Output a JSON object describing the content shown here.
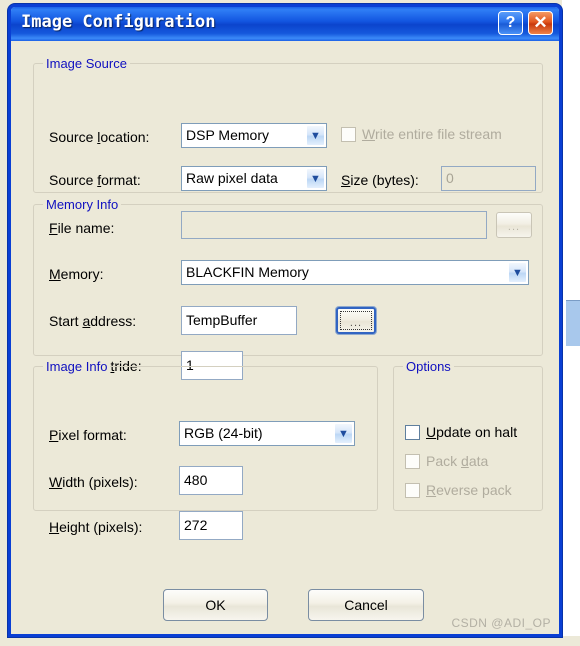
{
  "window": {
    "title": "Image Configuration",
    "help_button": "?",
    "close_button": "✕",
    "accent_titlebar": "#1255e0",
    "face_color": "#ece9d8",
    "group_title_color": "#1010c0"
  },
  "image_source": {
    "group_title": "Image Source",
    "source_location": {
      "label_pre": "Source ",
      "label_mnemonic": "l",
      "label_post": "ocation:",
      "value": "DSP Memory",
      "arrow": "▼"
    },
    "source_format": {
      "label_pre": "Source ",
      "label_mnemonic": "f",
      "label_post": "ormat:",
      "value": "Raw pixel data",
      "arrow": "▼"
    },
    "file_name": {
      "label_pre": "",
      "label_mnemonic": "F",
      "label_post": "ile name:",
      "value": "",
      "browse": "..."
    },
    "write_entire_file_stream": {
      "label_pre": "",
      "label_mnemonic": "W",
      "label_post": "rite entire file stream",
      "checked": false,
      "enabled": false
    },
    "size_bytes": {
      "label_pre": "",
      "label_mnemonic": "S",
      "label_post": "ize (bytes):",
      "value": "0",
      "enabled": false
    }
  },
  "memory_info": {
    "group_title": "Memory Info",
    "memory": {
      "label_pre": "",
      "label_mnemonic": "M",
      "label_post": "emory:",
      "value": "BLACKFIN Memory",
      "arrow": "▼"
    },
    "start_address": {
      "label_pre": "Start ",
      "label_mnemonic": "a",
      "label_post": "ddress:",
      "value": "TempBuffer",
      "browse": "..."
    },
    "memory_stride": {
      "label_pre": "Memory s",
      "label_mnemonic": "t",
      "label_post": "ride:",
      "value": "1"
    }
  },
  "image_info": {
    "group_title": "Image Info",
    "pixel_format": {
      "label_pre": "",
      "label_mnemonic": "P",
      "label_post": "ixel format:",
      "value": "RGB (24-bit)",
      "arrow": "▼"
    },
    "width": {
      "label_pre": "",
      "label_mnemonic": "W",
      "label_post": "idth (pixels):",
      "value": "480"
    },
    "height": {
      "label_pre": "",
      "label_mnemonic": "H",
      "label_post": "eight (pixels):",
      "value": "272"
    }
  },
  "options": {
    "group_title": "Options",
    "update_on_halt": {
      "label_pre": "",
      "label_mnemonic": "U",
      "label_post": "pdate on halt",
      "checked": false,
      "enabled": true
    },
    "pack_data": {
      "label_pre": "Pack ",
      "label_mnemonic": "d",
      "label_post": "ata",
      "checked": false,
      "enabled": false
    },
    "reverse_pack": {
      "label_pre": "",
      "label_mnemonic": "R",
      "label_post": "everse pack",
      "checked": false,
      "enabled": false
    }
  },
  "footer": {
    "ok_label": "OK",
    "cancel_label": "Cancel",
    "watermark": "CSDN @ADI_OP"
  }
}
